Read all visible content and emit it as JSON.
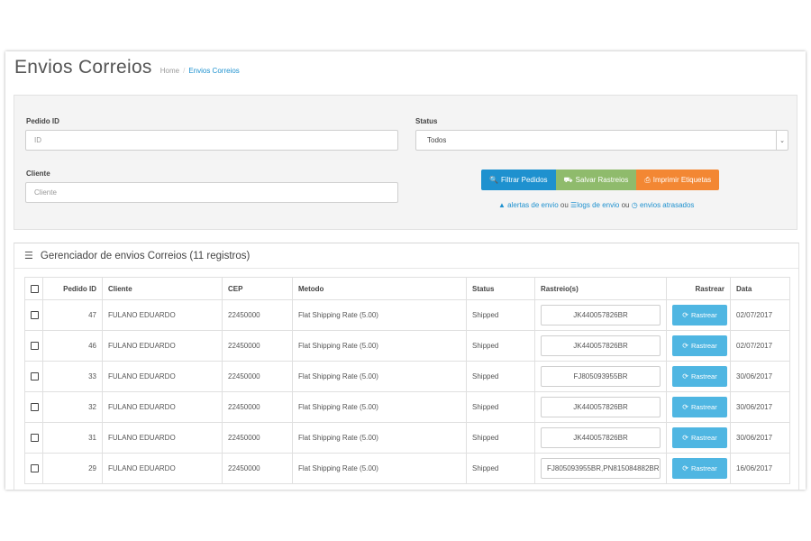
{
  "page": {
    "title": "Envios Correios",
    "breadcrumb": [
      {
        "label": "Home"
      },
      {
        "label": "Envios Correios"
      }
    ]
  },
  "filter": {
    "order_id_label": "Pedido ID",
    "order_id_placeholder": "ID",
    "customer_label": "Cliente",
    "customer_placeholder": "Cliente",
    "status_label": "Status",
    "status_selected": "Todos",
    "buttons": {
      "filter": "Filtrar Pedidos",
      "save": "Salvar Rastreios",
      "print": "Imprimir Etiquetas"
    },
    "links": {
      "alerts": "alertas de envio",
      "sep1": "ou",
      "logs": "logs de envio",
      "sep2": "ou",
      "late": "envios atrasados"
    }
  },
  "list": {
    "heading": "Gerenciador de envios Correios (11 registros)",
    "columns": {
      "order_id": "Pedido ID",
      "customer": "Cliente",
      "cep": "CEP",
      "method": "Metodo",
      "status": "Status",
      "tracking": "Rastreio(s)",
      "track": "Rastrear",
      "date": "Data"
    },
    "track_button_label": "Rastrear",
    "rows": [
      {
        "id": "47",
        "customer": "FULANO EDUARDO",
        "cep": "22450000",
        "method": "Flat Shipping Rate (5.00)",
        "status": "Shipped",
        "tracking": "JK440057826BR",
        "date": "02/07/2017"
      },
      {
        "id": "46",
        "customer": "FULANO EDUARDO",
        "cep": "22450000",
        "method": "Flat Shipping Rate (5.00)",
        "status": "Shipped",
        "tracking": "JK440057826BR",
        "date": "02/07/2017"
      },
      {
        "id": "33",
        "customer": "FULANO EDUARDO",
        "cep": "22450000",
        "method": "Flat Shipping Rate (5.00)",
        "status": "Shipped",
        "tracking": "FJ805093955BR",
        "date": "30/06/2017"
      },
      {
        "id": "32",
        "customer": "FULANO EDUARDO",
        "cep": "22450000",
        "method": "Flat Shipping Rate (5.00)",
        "status": "Shipped",
        "tracking": "JK440057826BR",
        "date": "30/06/2017"
      },
      {
        "id": "31",
        "customer": "FULANO EDUARDO",
        "cep": "22450000",
        "method": "Flat Shipping Rate (5.00)",
        "status": "Shipped",
        "tracking": "JK440057826BR",
        "date": "30/06/2017"
      },
      {
        "id": "29",
        "customer": "FULANO EDUARDO",
        "cep": "22450000",
        "method": "Flat Shipping Rate (5.00)",
        "status": "Shipped",
        "tracking": "FJ805093955BR,PN815084882BR",
        "date": "16/06/2017"
      }
    ]
  },
  "colors": {
    "primary": "#1e91cf",
    "success": "#8fbb6c",
    "warning": "#f38733",
    "info": "#4fb6e2"
  },
  "icons": {
    "filter_button": "search-icon",
    "save_button": "truck-icon",
    "print_button": "print-icon",
    "alerts_link": "warning-icon",
    "logs_link": "database-icon",
    "late_link": "clock-icon",
    "list_heading": "list-icon",
    "track_button": "refresh-icon"
  }
}
